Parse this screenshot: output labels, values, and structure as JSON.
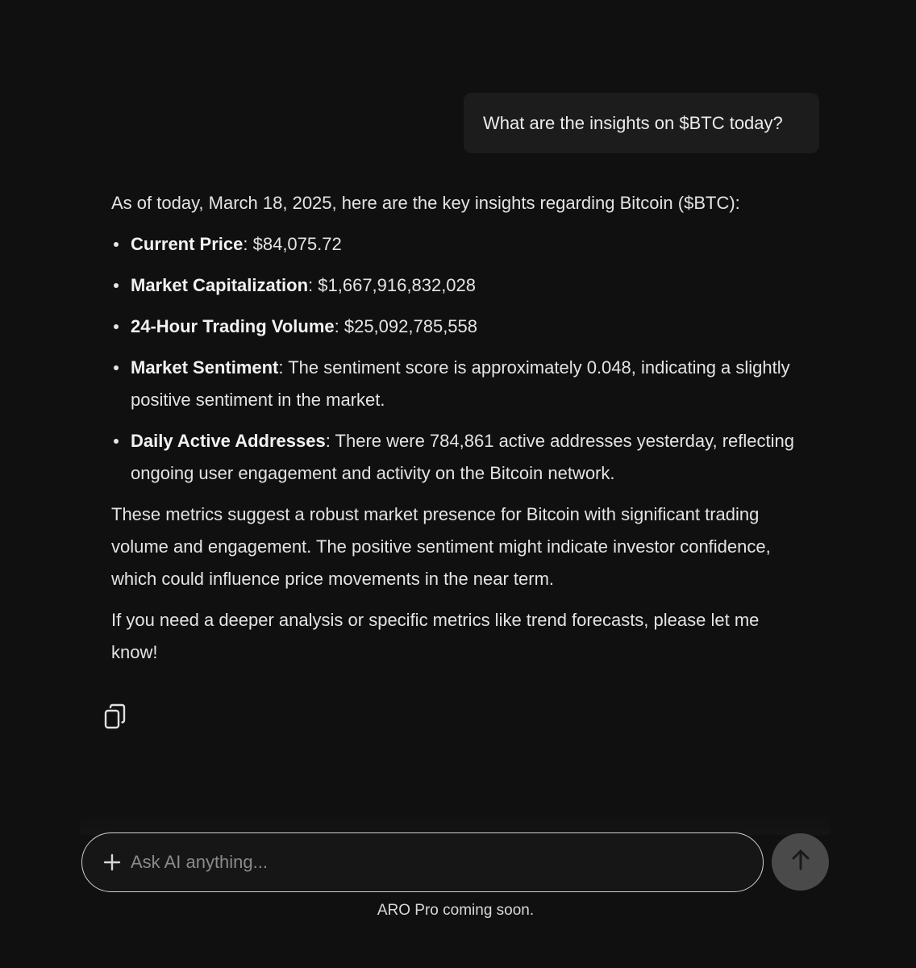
{
  "user_message": "What are the insights on $BTC today?",
  "answer": {
    "intro": "As of today, March 18, 2025, here are the key insights regarding Bitcoin ($BTC):",
    "bullets": [
      {
        "label": "Current Price",
        "text": ": $84,075.72"
      },
      {
        "label": "Market Capitalization",
        "text": ": $1,667,916,832,028"
      },
      {
        "label": "24-Hour Trading Volume",
        "text": ": $25,092,785,558"
      },
      {
        "label": "Market Sentiment",
        "text": ": The sentiment score is approximately 0.048, indicating a slightly positive sentiment in the market."
      },
      {
        "label": "Daily Active Addresses",
        "text": ": There were 784,861 active addresses yesterday, reflecting ongoing user engagement and activity on the Bitcoin network."
      }
    ],
    "paragraph_1": "These metrics suggest a robust market presence for Bitcoin with significant trading volume and engagement. The positive sentiment might indicate investor confidence, which could influence price movements in the near term.",
    "paragraph_2": "If you need a deeper analysis or specific metrics like trend forecasts, please let me know!"
  },
  "actions": {
    "copy_icon": "copy-icon"
  },
  "composer": {
    "placeholder": "Ask AI anything...",
    "value": "",
    "plus_icon": "plus-icon",
    "send_icon": "arrow-up-icon"
  },
  "footer_note": "ARO Pro coming soon.",
  "colors": {
    "background": "#101010",
    "bubble": "#1c1c1c",
    "send_button": "#4a4a4a"
  }
}
